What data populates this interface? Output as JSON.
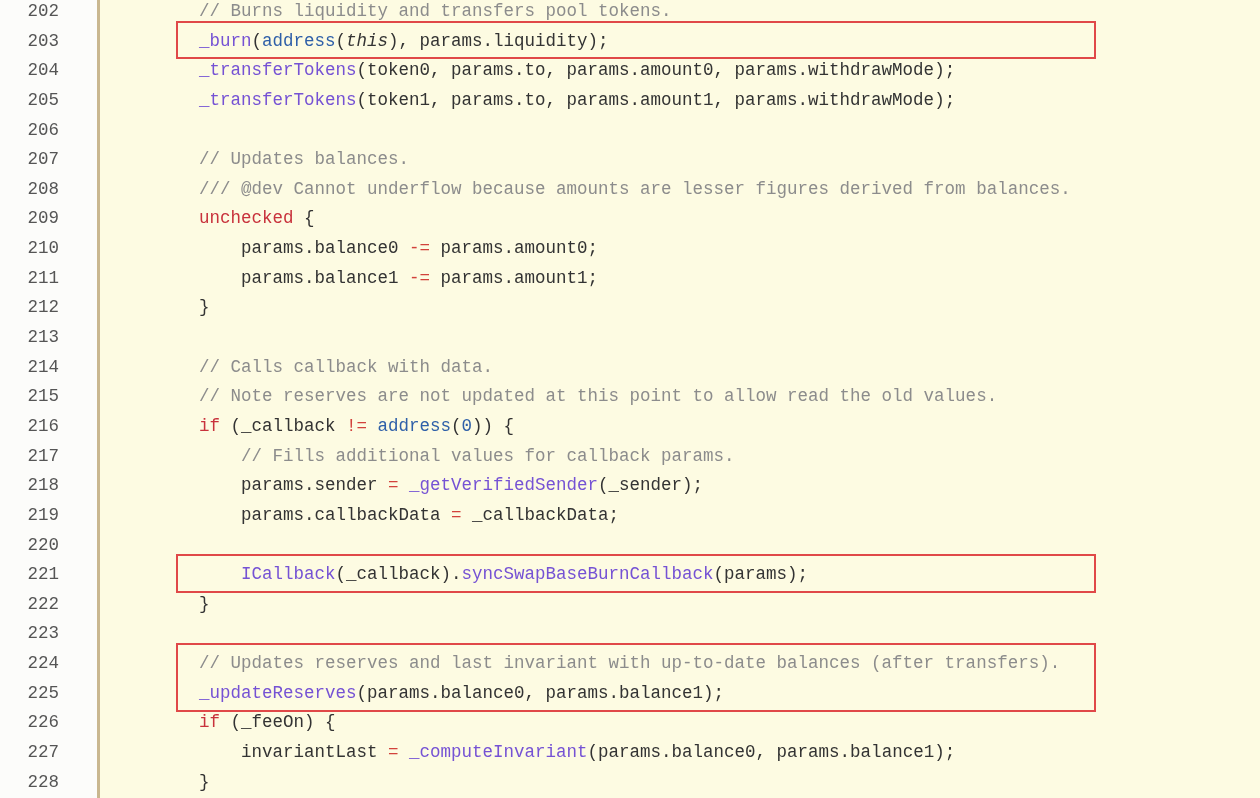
{
  "lines": [
    {
      "number": "202",
      "highlighted": false,
      "tokens": [
        {
          "kind": "comment",
          "text": "// Burns liquidity and transfers pool tokens."
        }
      ]
    },
    {
      "number": "203",
      "highlighted": true,
      "tokens": [
        {
          "kind": "function",
          "text": "_burn"
        },
        {
          "kind": "plain",
          "text": "("
        },
        {
          "kind": "builtin",
          "text": "address"
        },
        {
          "kind": "plain",
          "text": "("
        },
        {
          "kind": "italic",
          "text": "this"
        },
        {
          "kind": "plain",
          "text": "), params.liquidity);"
        }
      ]
    },
    {
      "number": "204",
      "highlighted": false,
      "tokens": [
        {
          "kind": "function",
          "text": "_transferTokens"
        },
        {
          "kind": "plain",
          "text": "(token0, params.to, params.amount0, params.withdrawMode);"
        }
      ]
    },
    {
      "number": "205",
      "highlighted": false,
      "tokens": [
        {
          "kind": "function",
          "text": "_transferTokens"
        },
        {
          "kind": "plain",
          "text": "(token1, params.to, params.amount1, params.withdrawMode);"
        }
      ]
    },
    {
      "number": "206",
      "highlighted": false
    },
    {
      "number": "207",
      "highlighted": false,
      "tokens": [
        {
          "kind": "comment",
          "text": "// Updates balances."
        }
      ]
    },
    {
      "number": "208",
      "highlighted": false,
      "tokens": [
        {
          "kind": "comment",
          "text": "/// @dev Cannot underflow because amounts are lesser figures derived from balances."
        }
      ]
    },
    {
      "number": "209",
      "highlighted": false,
      "tokens": [
        {
          "kind": "keyword",
          "text": "unchecked"
        },
        {
          "kind": "plain",
          "text": " {"
        }
      ]
    },
    {
      "number": "210",
      "highlighted": false,
      "tokens": [
        {
          "kind": "plain",
          "text": "    params.balance0 "
        },
        {
          "kind": "operator",
          "text": "-="
        },
        {
          "kind": "plain",
          "text": " params.amount0;"
        }
      ]
    },
    {
      "number": "211",
      "highlighted": false,
      "tokens": [
        {
          "kind": "plain",
          "text": "    params.balance1 "
        },
        {
          "kind": "operator",
          "text": "-="
        },
        {
          "kind": "plain",
          "text": " params.amount1;"
        }
      ]
    },
    {
      "number": "212",
      "highlighted": false,
      "tokens": [
        {
          "kind": "plain",
          "text": "}"
        }
      ]
    },
    {
      "number": "213",
      "highlighted": false
    },
    {
      "number": "214",
      "highlighted": false,
      "tokens": [
        {
          "kind": "comment",
          "text": "// Calls callback with data."
        }
      ]
    },
    {
      "number": "215",
      "highlighted": false,
      "tokens": [
        {
          "kind": "comment",
          "text": "// Note reserves are not updated at this point to allow read the old values."
        }
      ]
    },
    {
      "number": "216",
      "highlighted": false,
      "tokens": [
        {
          "kind": "keyword",
          "text": "if"
        },
        {
          "kind": "plain",
          "text": " (_callback "
        },
        {
          "kind": "operator",
          "text": "!="
        },
        {
          "kind": "builtin",
          "text": " address"
        },
        {
          "kind": "plain",
          "text": "("
        },
        {
          "kind": "builtin",
          "text": "0"
        },
        {
          "kind": "plain",
          "text": ")) {"
        }
      ]
    },
    {
      "number": "217",
      "highlighted": false,
      "tokens": [
        {
          "kind": "comment",
          "text": "    // Fills additional values for callback params."
        }
      ]
    },
    {
      "number": "218",
      "highlighted": false,
      "tokens": [
        {
          "kind": "plain",
          "text": "    params.sender "
        },
        {
          "kind": "operator",
          "text": "="
        },
        {
          "kind": "function",
          "text": " _getVerifiedSender"
        },
        {
          "kind": "plain",
          "text": "(_sender);"
        }
      ]
    },
    {
      "number": "219",
      "highlighted": false,
      "tokens": [
        {
          "kind": "plain",
          "text": "    params.callbackData "
        },
        {
          "kind": "operator",
          "text": "="
        },
        {
          "kind": "plain",
          "text": " _callbackData;"
        }
      ]
    },
    {
      "number": "220",
      "highlighted": false
    },
    {
      "number": "221",
      "highlighted": true,
      "tokens": [
        {
          "kind": "function",
          "text": "    ICallback"
        },
        {
          "kind": "plain",
          "text": "(_callback)."
        },
        {
          "kind": "function",
          "text": "syncSwapBaseBurnCallback"
        },
        {
          "kind": "plain",
          "text": "(params);"
        }
      ]
    },
    {
      "number": "222",
      "highlighted": false,
      "tokens": [
        {
          "kind": "plain",
          "text": "}"
        }
      ]
    },
    {
      "number": "223",
      "highlighted": false
    },
    {
      "number": "224",
      "highlighted": true,
      "tokens": [
        {
          "kind": "comment",
          "text": "// Updates reserves and last invariant with up-to-date balances (after transfers)."
        }
      ]
    },
    {
      "number": "225",
      "highlighted": true,
      "tokens": [
        {
          "kind": "function",
          "text": "_updateReserves"
        },
        {
          "kind": "plain",
          "text": "(params.balance0, params.balance1);"
        }
      ]
    },
    {
      "number": "226",
      "highlighted": false,
      "tokens": [
        {
          "kind": "keyword",
          "text": "if"
        },
        {
          "kind": "plain",
          "text": " (_feeOn) {"
        }
      ]
    },
    {
      "number": "227",
      "highlighted": false,
      "tokens": [
        {
          "kind": "plain",
          "text": "    invariantLast "
        },
        {
          "kind": "operator",
          "text": "="
        },
        {
          "kind": "function",
          "text": " _computeInvariant"
        },
        {
          "kind": "plain",
          "text": "(params.balance0, params.balance1);"
        }
      ]
    },
    {
      "number": "228",
      "highlighted": false,
      "tokens": [
        {
          "kind": "plain",
          "text": "}"
        }
      ]
    }
  ]
}
